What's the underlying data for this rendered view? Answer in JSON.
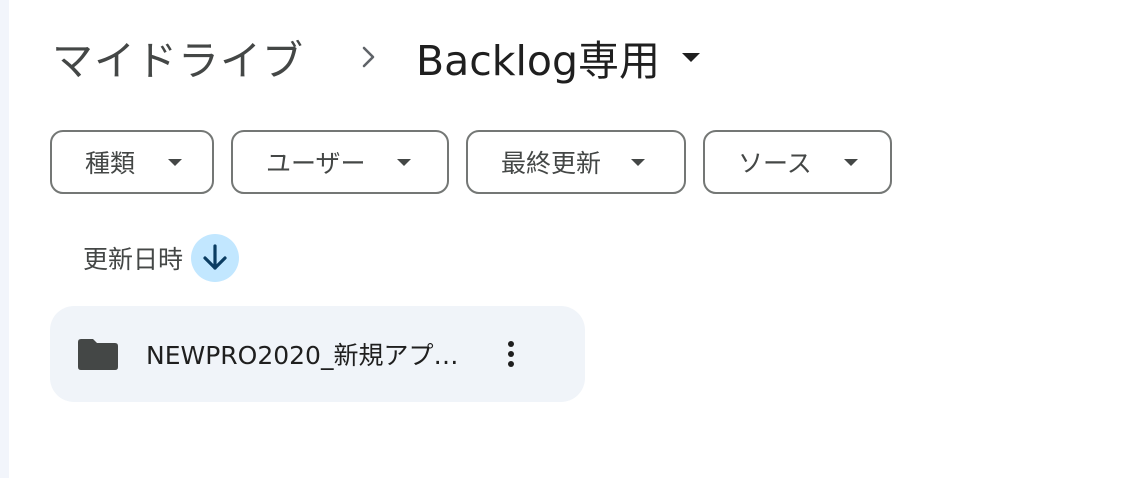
{
  "breadcrumb": {
    "root": "マイドライブ",
    "separator_icon": "chevron-right-icon",
    "current": "Backlog専用",
    "current_caret_icon": "arrow-drop-down-icon"
  },
  "filters": [
    {
      "label": "種類",
      "icon": "arrow-drop-down-icon"
    },
    {
      "label": "ユーザー",
      "icon": "arrow-drop-down-icon"
    },
    {
      "label": "最終更新",
      "icon": "arrow-drop-down-icon"
    },
    {
      "label": "ソース",
      "icon": "arrow-drop-down-icon"
    }
  ],
  "sort": {
    "label": "更新日時",
    "direction_icon": "arrow-downward-icon"
  },
  "files": [
    {
      "type_icon": "folder-icon",
      "name": "NEWPRO2020_新規アプリ...",
      "menu_icon": "more-vert-icon"
    }
  ],
  "colors": {
    "accent_sort_bg": "#c2e7ff",
    "accent_sort_fg": "#0b3d62",
    "row_bg": "#f0f4f9",
    "chip_border": "#747775"
  }
}
